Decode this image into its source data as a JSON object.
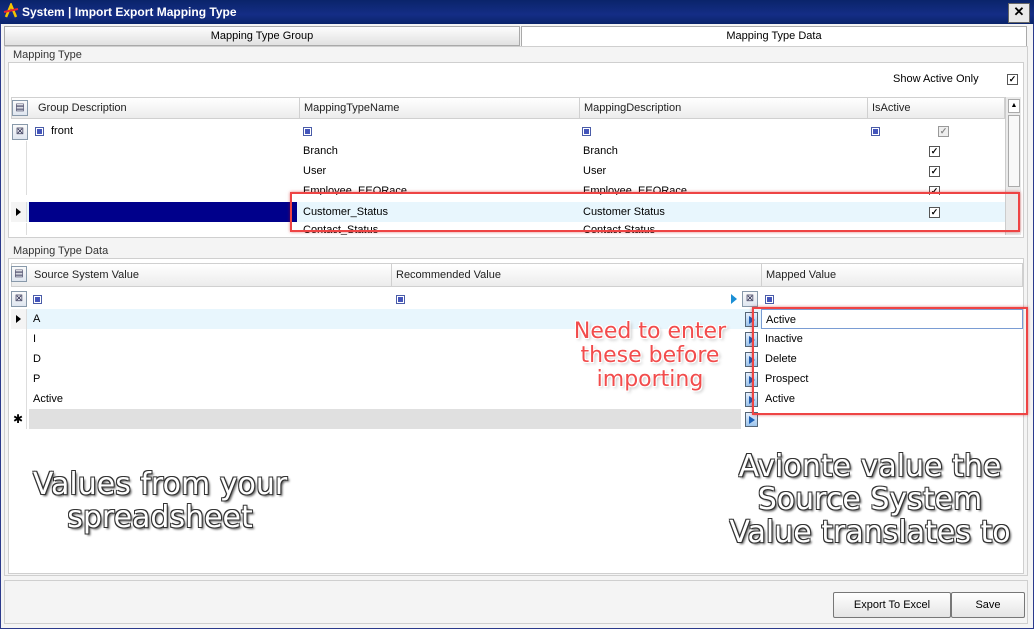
{
  "window": {
    "title": "System | Import Export Mapping Type",
    "close_glyph": "✕"
  },
  "tabs": [
    {
      "label": "Mapping Type Group",
      "active": false
    },
    {
      "label": "Mapping Type Data",
      "active": true
    }
  ],
  "mapping_type": {
    "legend": "Mapping Type",
    "show_active_only_label": "Show Active Only",
    "show_active_only_checked": true,
    "columns": [
      "Group Description",
      "MappingTypeName",
      "MappingDescription",
      "IsActive"
    ],
    "group_value": "front",
    "rows": [
      {
        "name": "Branch",
        "description": "Branch",
        "active": true
      },
      {
        "name": "User",
        "description": "User",
        "active": true
      },
      {
        "name": "Employee_EEORace",
        "description": "Employee_EEORace",
        "active": true
      },
      {
        "name": "Customer_Status",
        "description": "Customer Status",
        "active": true,
        "selected": true
      },
      {
        "name": "Contact_Status",
        "description": "Contact Status",
        "active": true
      }
    ]
  },
  "mapping_type_data": {
    "legend": "Mapping Type Data",
    "columns": [
      "Source System Value",
      "Recommended Value",
      "Mapped Value"
    ],
    "rows": [
      {
        "source": "A",
        "recommended": "",
        "mapped": "Active",
        "current": true
      },
      {
        "source": "I",
        "recommended": "",
        "mapped": "Inactive"
      },
      {
        "source": "D",
        "recommended": "",
        "mapped": "Delete"
      },
      {
        "source": "P",
        "recommended": "",
        "mapped": "Prospect"
      },
      {
        "source": "Active",
        "recommended": "",
        "mapped": "Active"
      }
    ],
    "new_row_glyph": "✱"
  },
  "annotations": {
    "middle_lines": [
      "Need to enter",
      "these before",
      "importing"
    ],
    "left_lines": [
      "Values from your",
      "spreadsheet"
    ],
    "right_lines": [
      "Avionte value the",
      "Source System",
      "Value translates to"
    ],
    "middle_color": "#f24c4c"
  },
  "footer": {
    "export_label": "Export To Excel",
    "save_label": "Save"
  },
  "colors": {
    "titlebar": "#0a246a",
    "selection": "#00008b",
    "highlight": "#ee4444"
  }
}
